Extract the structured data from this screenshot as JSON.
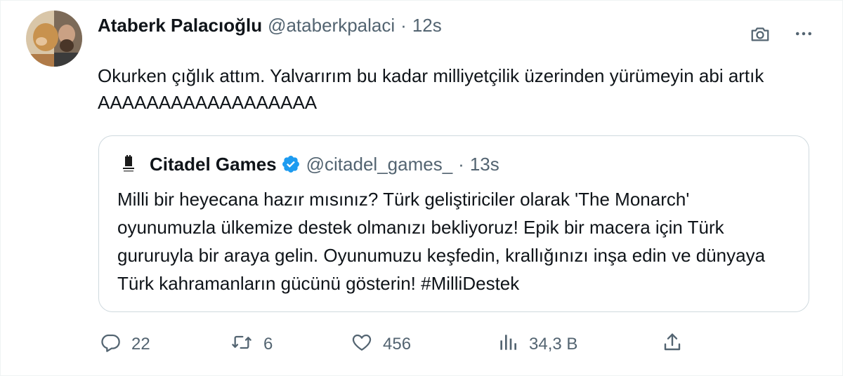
{
  "author": {
    "display_name": "Ataberk Palacıoğlu",
    "handle": "@ataberkpalaci",
    "separator": "·",
    "time": "12s"
  },
  "tweet": {
    "text": "Okurken çığlık attım. Yalvarırım bu kadar milliyetçilik üzerinden yürümeyin abi artık AAAAAAAAAAAAAAAAAA"
  },
  "quoted": {
    "display_name": "Citadel Games",
    "handle": "@citadel_games_",
    "separator": "·",
    "time": "13s",
    "text": "Milli bir heyecana hazır mısınız? Türk geliştiriciler olarak 'The Monarch' oyunumuzla ülkemize destek olmanızı bekliyoruz! Epik bir macera için Türk gururuyla bir araya gelin. Oyunumuzu keşfedin, krallığınızı inşa edin ve dünyaya Türk kahramanların gücünü gösterin! #MilliDestek",
    "verified_color": "#1d9bf0"
  },
  "actions": {
    "replies": "22",
    "retweets": "6",
    "likes": "456",
    "views": "34,3 B"
  },
  "icons": {
    "camera": "camera-icon",
    "more": "more-icon",
    "reply": "reply-icon",
    "retweet": "retweet-icon",
    "like": "like-icon",
    "views": "views-icon",
    "share": "share-icon"
  }
}
